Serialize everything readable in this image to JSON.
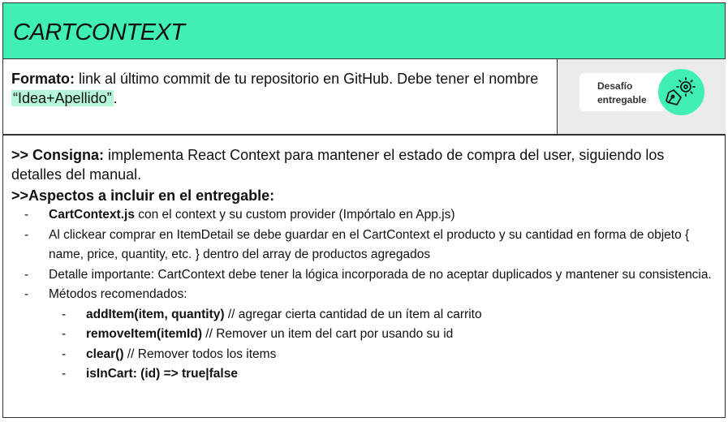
{
  "title": "CARTCONTEXT",
  "format": {
    "label": "Formato:",
    "text": " link al último commit de tu repositorio en GitHub. Debe tener el nombre ",
    "highlight": "“Idea+Apellido”",
    "end": "."
  },
  "badge": {
    "line1": "Desafío",
    "line2": "entregable",
    "icon": "pen-nib-gear-icon"
  },
  "consigna": {
    "label": ">> Consigna:",
    "text": " implementa React Context para mantener el estado de compra del user, siguiendo los detalles del manual."
  },
  "aspectos": ">>Aspectos a incluir en el entregable:",
  "dash": "-",
  "items": [
    {
      "bold": "CartContext.js",
      "text": " con el context y su custom provider (Impórtalo en App.js)"
    },
    {
      "bold": "",
      "text": "Al clickear comprar en ItemDetail se debe guardar en el CartContext el producto y su cantidad en forma de objeto { name, price, quantity, etc. } dentro del array de productos agregados"
    },
    {
      "bold": "",
      "text": "Detalle importante: CartContext debe tener la lógica incorporada de no aceptar duplicados y mantener su consistencia."
    },
    {
      "bold": "",
      "text": "Métodos recomendados:"
    }
  ],
  "methods": [
    {
      "bold": "addItem(item, quantity)",
      "text": " // agregar cierta cantidad de un ítem al carrito"
    },
    {
      "bold": "removeItem(itemId)",
      "text": " // Remover un item del cart por usando su id"
    },
    {
      "bold": "clear()",
      "text": " // Remover todos los items"
    },
    {
      "bold": "isInCart: (id) => true|false",
      "text": ""
    }
  ],
  "colors": {
    "accent": "#3ff0b2",
    "highlight": "#b6f6d9",
    "badge_bg": "#ebebeb"
  }
}
